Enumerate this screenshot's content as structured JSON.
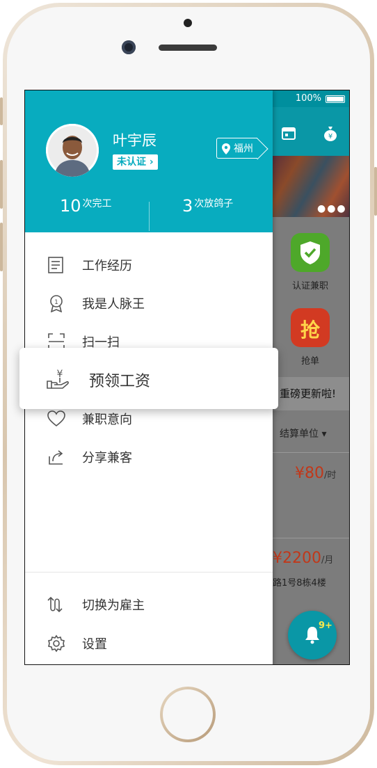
{
  "status_bar": {
    "battery": "100%"
  },
  "drawer": {
    "user": {
      "name": "叶宇辰",
      "verify_status": "未认证"
    },
    "location": "福州",
    "stats": [
      {
        "count": "10",
        "label": "次完工"
      },
      {
        "count": "3",
        "label": "次放鸽子"
      }
    ],
    "menu": [
      {
        "label": "工作经历",
        "icon": "work-history-icon"
      },
      {
        "label": "我是人脉王",
        "icon": "medal-icon"
      },
      {
        "label": "扫一扫",
        "icon": "scan-icon"
      },
      {
        "label": "兼职意向",
        "icon": "heart-icon"
      },
      {
        "label": "分享兼客",
        "icon": "share-icon"
      }
    ],
    "bottom_menu": [
      {
        "label": "切换为雇主",
        "icon": "switch-icon"
      },
      {
        "label": "设置",
        "icon": "gear-icon"
      }
    ]
  },
  "popup": {
    "label": "预领工资",
    "icon": "salary-hand-icon"
  },
  "background": {
    "tiles": [
      {
        "label": "认证兼职",
        "color": "#4ea82a"
      },
      {
        "label": "抢单",
        "color": "#d23a22",
        "glyph": "抢"
      }
    ],
    "ticker": "重磅更新啦!",
    "filter_label": "结算单位 ▾",
    "jobs": [
      {
        "price": "¥80",
        "unit": "/时"
      },
      {
        "price": "¥2200",
        "unit": "/月",
        "address": "路1号8栋4楼"
      }
    ],
    "notification_badge": "9+"
  },
  "colors": {
    "accent": "#08acbf",
    "price": "#c0381a"
  }
}
